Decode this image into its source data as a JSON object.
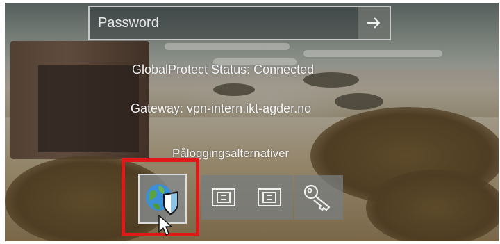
{
  "login": {
    "password_placeholder": "Password",
    "submit_icon": "arrow-right-icon"
  },
  "status": {
    "globalprotect": "GlobalProtect Status: Connected",
    "gateway": "Gateway: vpn-intern.ikt-agder.no"
  },
  "signin_options": {
    "title": "Påloggingsalternativer",
    "options": [
      {
        "icon": "globalprotect-globe-shield-icon"
      },
      {
        "icon": "smart-card-icon"
      },
      {
        "icon": "smart-card-pin-icon"
      },
      {
        "icon": "key-icon"
      }
    ],
    "selected_index": 0
  },
  "colors": {
    "highlight": "#e01818",
    "text": "#f4f4f4"
  }
}
